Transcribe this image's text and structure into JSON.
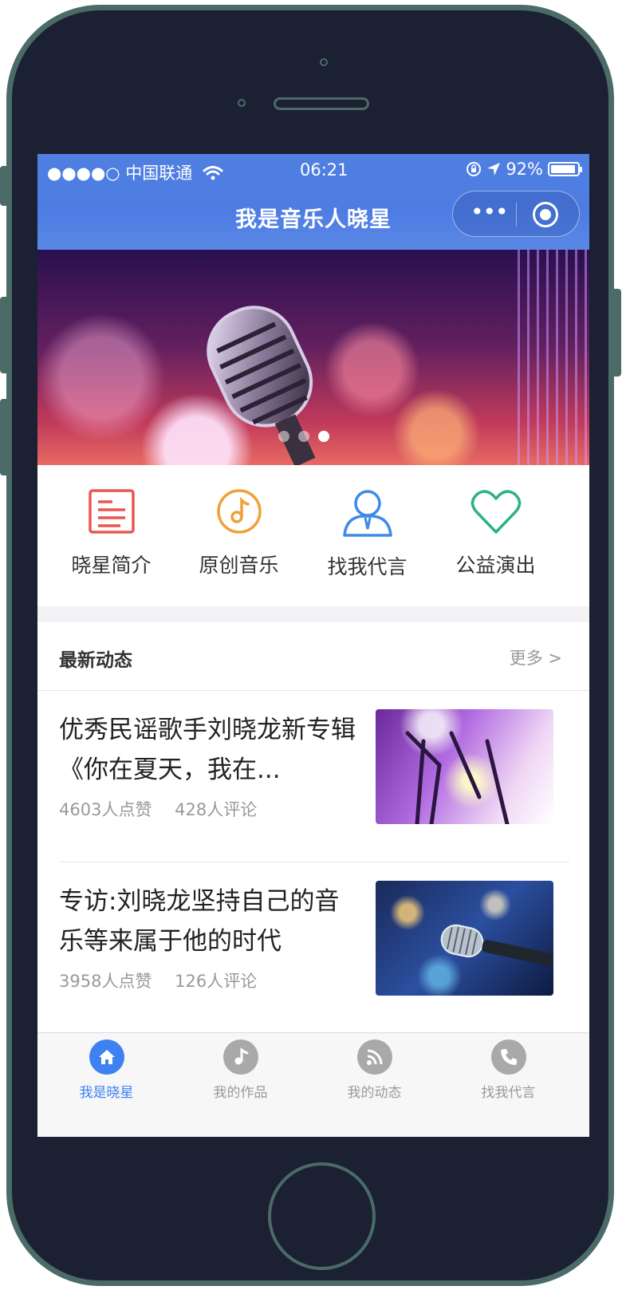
{
  "status_bar": {
    "carrier": "●●●●○ 中国联通",
    "time": "06:21",
    "battery": "92%"
  },
  "header": {
    "title": "我是音乐人晓星",
    "capsule_more": "•••"
  },
  "banner": {
    "page_count": 3,
    "active_index": 2
  },
  "categories": [
    {
      "label": "晓星简介",
      "icon": "document-icon",
      "color": "#e8574f"
    },
    {
      "label": "原创音乐",
      "icon": "music-note-icon",
      "color": "#f0a038"
    },
    {
      "label": "找我代言",
      "icon": "person-tie-icon",
      "color": "#3d8ae8"
    },
    {
      "label": "公益演出",
      "icon": "heart-icon",
      "color": "#2fb08c"
    }
  ],
  "news": {
    "heading": "最新动态",
    "more": "更多 >",
    "articles": [
      {
        "title": "优秀民谣歌手刘晓龙新专辑《你在夏天，我在...",
        "likes": "4603人点赞",
        "comments": "428人评论"
      },
      {
        "title": "专访:刘晓龙坚持自己的音乐等来属于他的时代",
        "likes": "3958人点赞",
        "comments": "126人评论"
      }
    ]
  },
  "tabbar": {
    "items": [
      {
        "label": "我是晓星",
        "icon": "home-icon",
        "active": true
      },
      {
        "label": "我的作品",
        "icon": "music-note-icon",
        "active": false
      },
      {
        "label": "我的动态",
        "icon": "rss-icon",
        "active": false
      },
      {
        "label": "找我代言",
        "icon": "phone-icon",
        "active": false
      }
    ]
  },
  "colors": {
    "accent": "#3d82f0",
    "header": "#4f7fe0",
    "phone_frame": "#4b6b67",
    "phone_body": "#1b2033"
  }
}
